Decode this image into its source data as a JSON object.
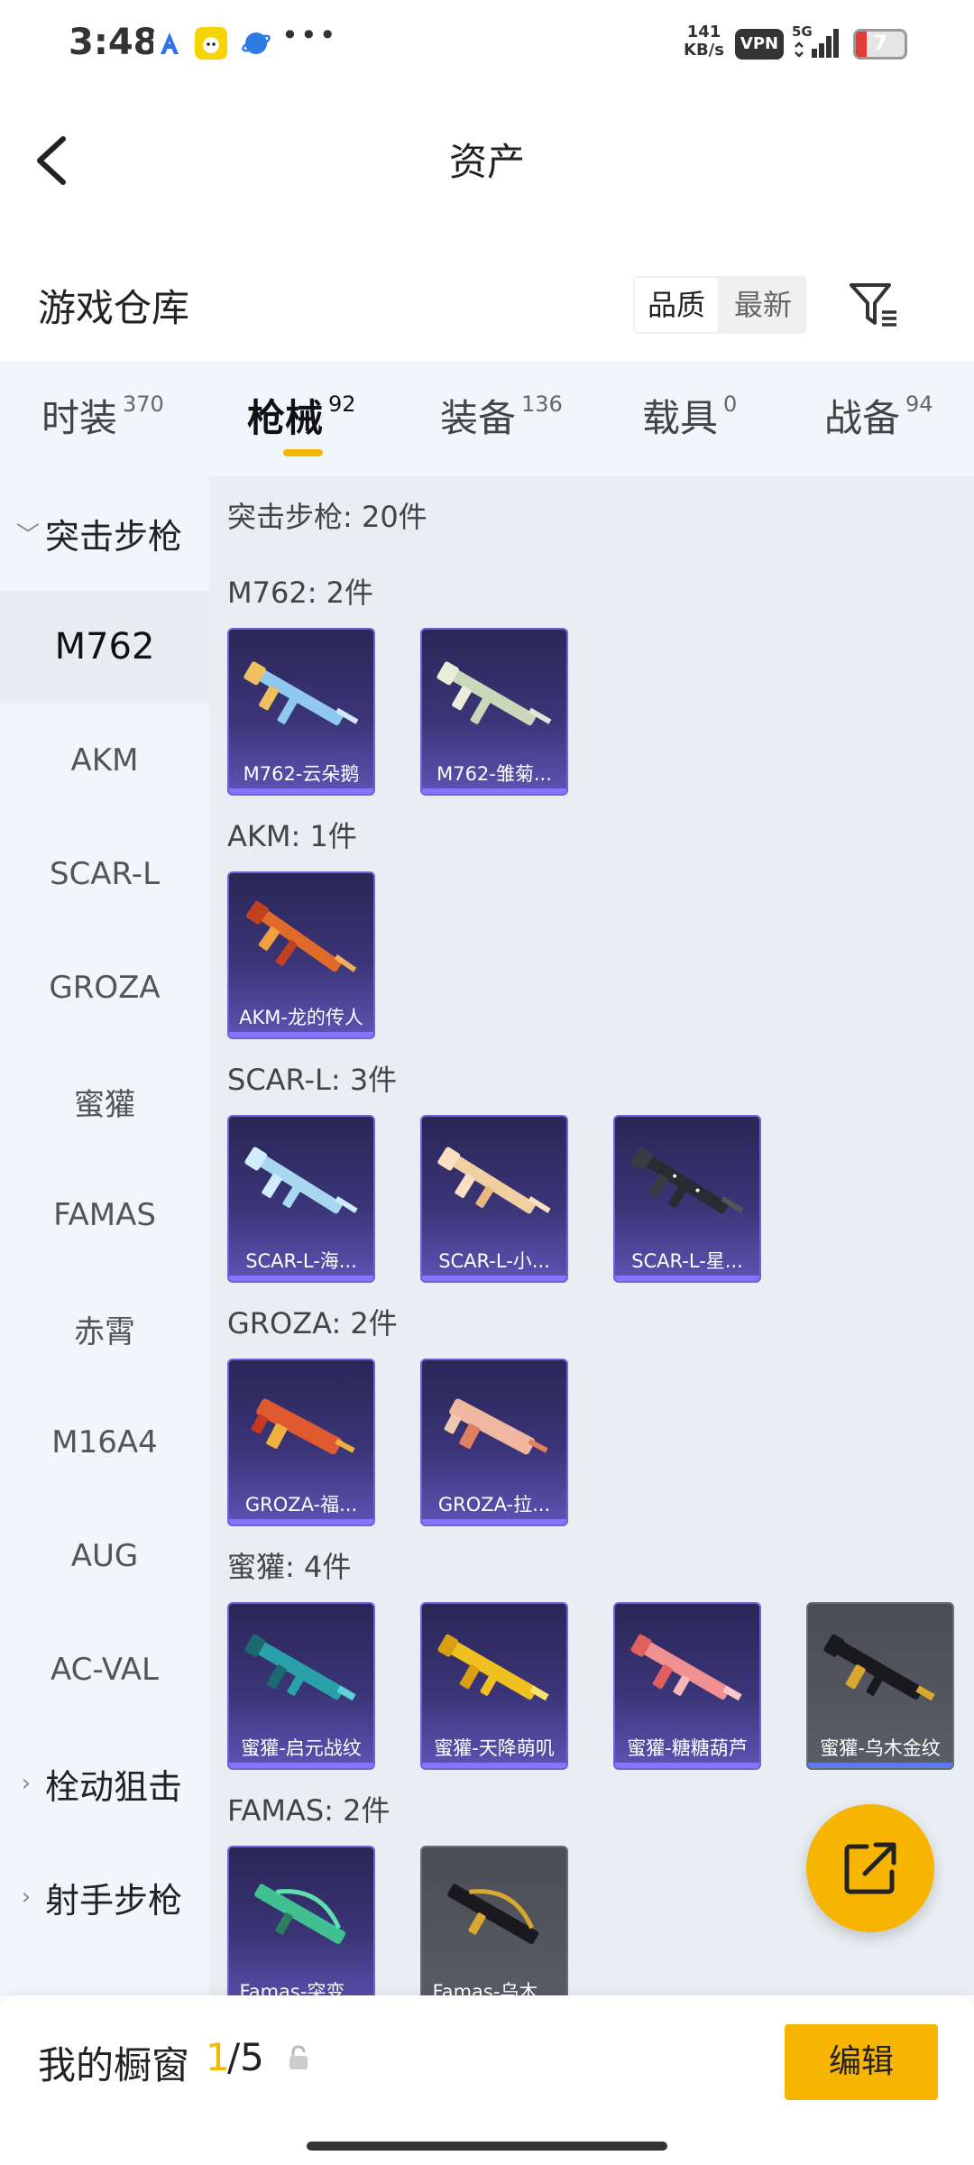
{
  "status_bar": {
    "time": "3:48",
    "net_speed_value": "141",
    "net_speed_unit": "KB/s",
    "vpn": "VPN",
    "network": "5G",
    "battery": "7",
    "icons": [
      "a-app-icon",
      "pet-app-icon",
      "browser-icon",
      "more-icon"
    ]
  },
  "header": {
    "title": "资产"
  },
  "warehouse": {
    "title": "游戏仓库",
    "sort_quality": "品质",
    "sort_newest": "最新"
  },
  "tabs": [
    {
      "label": "时装",
      "count": "370"
    },
    {
      "label": "枪械",
      "count": "92"
    },
    {
      "label": "装备",
      "count": "136"
    },
    {
      "label": "载具",
      "count": "0"
    },
    {
      "label": "战备",
      "count": "94"
    }
  ],
  "sidebar": {
    "category_open": "突击步枪",
    "items": [
      "M762",
      "AKM",
      "SCAR-L",
      "GROZA",
      "蜜獾",
      "FAMAS",
      "赤霄",
      "M16A4",
      "AUG",
      "AC-VAL"
    ],
    "category_2": "栓动狙击",
    "category_3": "射手步枪"
  },
  "content": {
    "header": "突击步枪: 20件",
    "groups": [
      {
        "title": "M762: 2件",
        "items": [
          "M762-云朵鹅",
          "M762-雏菊..."
        ]
      },
      {
        "title": "AKM: 1件",
        "items": [
          "AKM-龙的传人"
        ]
      },
      {
        "title": "SCAR-L: 3件",
        "items": [
          "SCAR-L-海...",
          "SCAR-L-小...",
          "SCAR-L-星..."
        ]
      },
      {
        "title": "GROZA: 2件",
        "items": [
          "GROZA-福...",
          "GROZA-拉..."
        ]
      },
      {
        "title": "蜜獾: 4件",
        "items": [
          "蜜獾-启元战纹",
          "蜜獾-天降萌叽",
          "蜜獾-糖糖葫芦",
          "蜜獾-乌木金纹"
        ]
      },
      {
        "title": "FAMAS: 2件",
        "items": [
          "Famas-突变...",
          "Famas-乌木..."
        ]
      }
    ]
  },
  "bottom": {
    "label": "我的橱窗",
    "count_current": "1",
    "count_total": "/5",
    "edit": "编辑"
  },
  "colors": {
    "accent": "#f7b500",
    "card_purple": "#3b3578",
    "card_gray": "#5a5d66"
  }
}
